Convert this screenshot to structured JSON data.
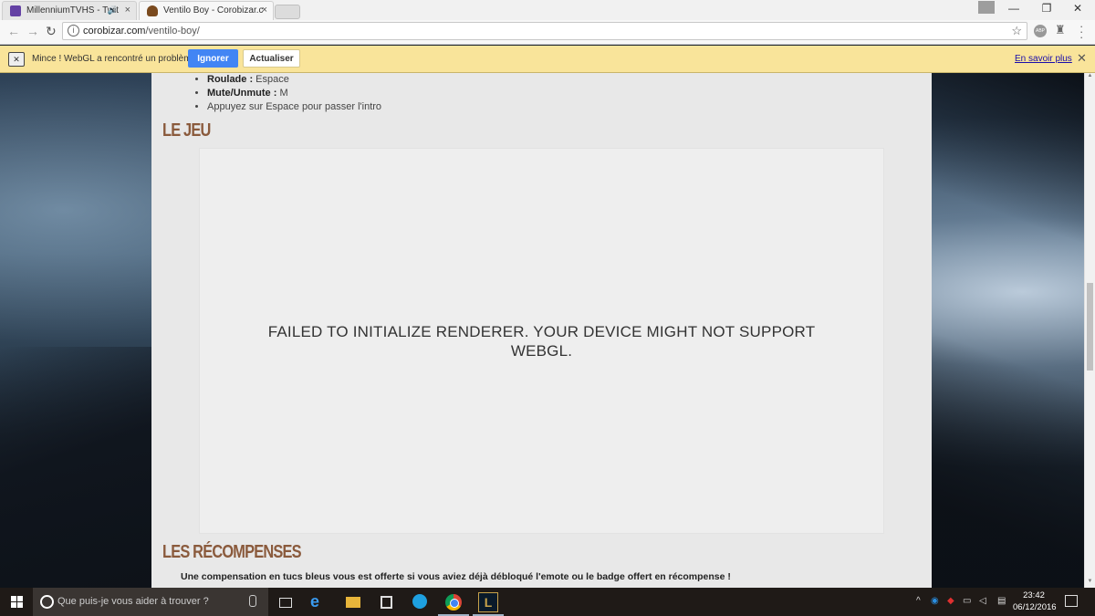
{
  "browser": {
    "tabs": [
      {
        "title": "MillenniumTVHS - Twit",
        "active": false,
        "favicon": "twitch-icon",
        "favicon_color": "#6441a4",
        "audio": true
      },
      {
        "title": "Ventilo Boy - Corobizar.c",
        "active": true,
        "favicon": "poop-icon",
        "favicon_color": "#7a4a1e"
      }
    ],
    "address": {
      "host": "corobizar.com",
      "path": "/ventilo-boy/"
    },
    "infobar": {
      "message": "Mince ! WebGL a rencontré un problème.",
      "ignore_label": "Ignorer",
      "refresh_label": "Actualiser",
      "learn_more": "En savoir plus"
    }
  },
  "page": {
    "controls": [
      {
        "key": "Roulade :",
        "value": " Espace"
      },
      {
        "key": "Mute/Unmute :",
        "value": " M"
      },
      {
        "key": "",
        "value": "Appuyez sur Espace pour passer l'intro"
      }
    ],
    "game_title": "LE JEU",
    "game_error": "FAILED TO INITIALIZE RENDERER. YOUR DEVICE MIGHT NOT SUPPORT WEBGL.",
    "rewards_title": "LES RÉCOMPENSES",
    "rewards_text": "Une compensation en tucs bleus vous est offerte si vous aviez déjà débloqué l'emote ou le badge offert en récompense !"
  },
  "taskbar": {
    "search_placeholder": "Que puis-je vous aider à trouver ?",
    "apps": [
      "task-view-icon",
      "edge-icon",
      "file-explorer-icon",
      "store-icon",
      "skype-icon",
      "chrome-icon",
      "league-of-legends-icon"
    ],
    "clock_time": "23:42",
    "clock_date": "06/12/2016"
  },
  "colors": {
    "accent_button": "#4285f4",
    "infobar_bg": "#f9e49a",
    "section_title": "#8a5a3c"
  }
}
